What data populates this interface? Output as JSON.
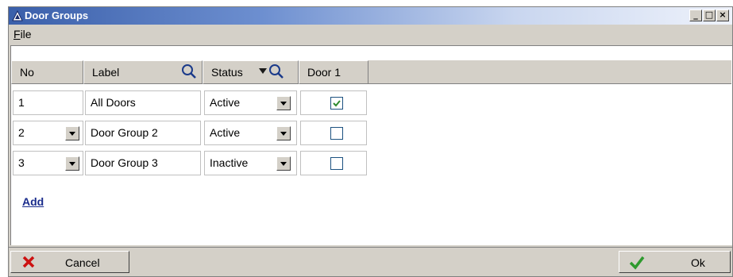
{
  "window": {
    "title": "Door Groups"
  },
  "menu": {
    "file_label": "File",
    "file_mnemonic": "F",
    "file_rest": "ile"
  },
  "columns": {
    "no": "No",
    "label": "Label",
    "status": "Status",
    "door1": "Door 1"
  },
  "rows": [
    {
      "no": "1",
      "label": "All Doors",
      "status": "Active",
      "door1_checked": true,
      "no_dropdown": false
    },
    {
      "no": "2",
      "label": "Door Group 2",
      "status": "Active",
      "door1_checked": false,
      "no_dropdown": true
    },
    {
      "no": "3",
      "label": "Door Group 3",
      "status": "Inactive",
      "door1_checked": false,
      "no_dropdown": true
    }
  ],
  "add_link": "Add",
  "buttons": {
    "cancel": "Cancel",
    "ok": "Ok"
  },
  "icons": {
    "title": "triangle-app-icon",
    "label_search": "magnifier-icon",
    "status_filter": "filter-magnifier-icon",
    "cancel": "red-x-icon",
    "ok": "green-check-icon"
  },
  "colors": {
    "cancel_icon": "#cc1111",
    "ok_icon": "#2e9a2e",
    "link": "#1a2c8c",
    "checkmark": "#2e8a2e"
  }
}
